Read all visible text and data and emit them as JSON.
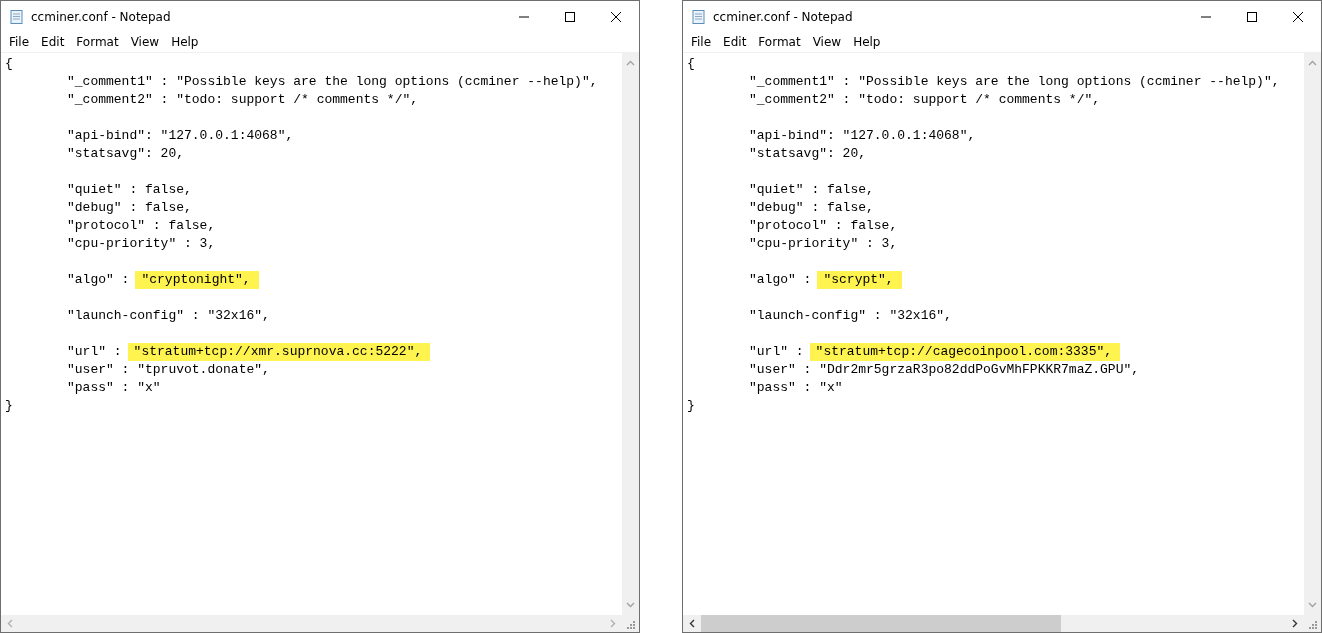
{
  "windows": [
    {
      "title": "ccminer.conf - Notepad",
      "menu": [
        "File",
        "Edit",
        "Format",
        "View",
        "Help"
      ],
      "open": "{",
      "close": "}",
      "horizontal_scrollbar": {
        "enabled": false
      },
      "groups": [
        [
          {
            "text": "\"_comment1\" : \"Possible keys are the long options (ccminer --help)\","
          },
          {
            "text": "\"_comment2\" : \"todo: support /* comments */\","
          }
        ],
        [
          {
            "text": "\"api-bind\": \"127.0.0.1:4068\","
          },
          {
            "text": "\"statsavg\": 20,"
          }
        ],
        [
          {
            "text": "\"quiet\" : false,"
          },
          {
            "text": "\"debug\" : false,"
          },
          {
            "text": "\"protocol\" : false,"
          },
          {
            "text": "\"cpu-priority\" : 3,"
          }
        ],
        [
          {
            "text": "\"algo\" :",
            "highlight": "\"cryptonight\","
          }
        ],
        [
          {
            "text": "\"launch-config\" : \"32x16\","
          }
        ],
        [
          {
            "text": "\"url\" :",
            "highlight": "\"stratum+tcp://xmr.suprnova.cc:5222\","
          },
          {
            "text": "\"user\" : \"tpruvot.donate\","
          },
          {
            "text": "\"pass\" : \"x\""
          }
        ]
      ]
    },
    {
      "title": "ccminer.conf - Notepad",
      "menu": [
        "File",
        "Edit",
        "Format",
        "View",
        "Help"
      ],
      "open": "{",
      "close": "}",
      "horizontal_scrollbar": {
        "enabled": true
      },
      "groups": [
        [
          {
            "text": "\"_comment1\" : \"Possible keys are the long options (ccminer --help)\","
          },
          {
            "text": "\"_comment2\" : \"todo: support /* comments */\","
          }
        ],
        [
          {
            "text": "\"api-bind\": \"127.0.0.1:4068\","
          },
          {
            "text": "\"statsavg\": 20,"
          }
        ],
        [
          {
            "text": "\"quiet\" : false,"
          },
          {
            "text": "\"debug\" : false,"
          },
          {
            "text": "\"protocol\" : false,"
          },
          {
            "text": "\"cpu-priority\" : 3,"
          }
        ],
        [
          {
            "text": "\"algo\" :",
            "highlight": "\"scrypt\","
          }
        ],
        [
          {
            "text": "\"launch-config\" : \"32x16\","
          }
        ],
        [
          {
            "text": "\"url\" :",
            "highlight": "\"stratum+tcp://cagecoinpool.com:3335\","
          },
          {
            "text": "\"user\" : \"Ddr2mr5grzaR3po82ddPoGvMhFPKKR7maZ.GPU\","
          },
          {
            "text": "\"pass\" : \"x\""
          }
        ]
      ]
    }
  ]
}
